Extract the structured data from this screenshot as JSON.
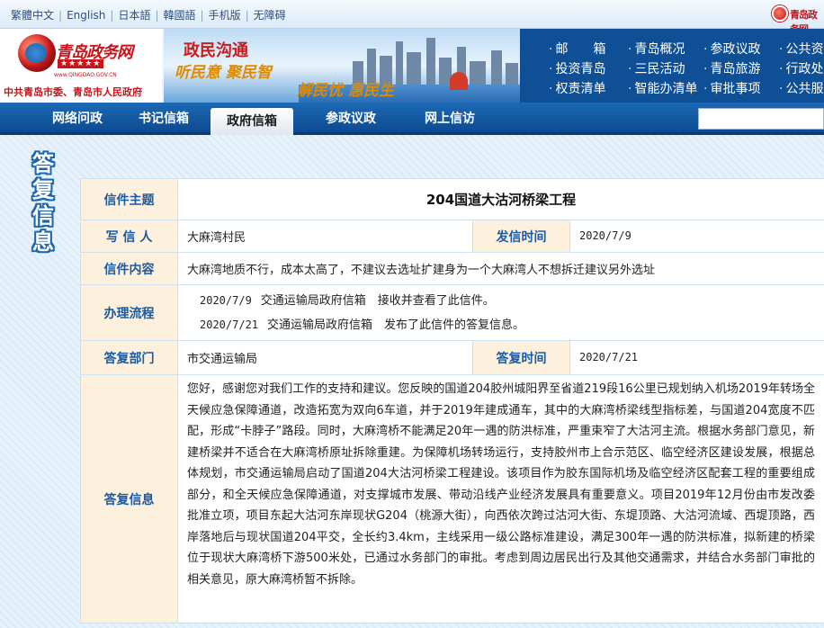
{
  "topbar": {
    "links": [
      "繁體中文",
      "English",
      "日本語",
      "韓國語",
      "手机版",
      "无障碍"
    ],
    "logo_text": "青岛政务网"
  },
  "banner": {
    "site_name": "青岛政务网",
    "stars": "★★★★★",
    "url": "www.QINGDAO.GOV.CN",
    "sub_title": "中共青岛市委、青岛市人民政府",
    "slogan_main": "政民沟通",
    "slogan_line1": "听民意 聚民智",
    "slogan_line2": "解民忧 惠民生",
    "quicklinks": [
      [
        "邮　　箱",
        "青岛概况",
        "参政议政",
        "公共资"
      ],
      [
        "投资青岛",
        "三民活动",
        "青岛旅游",
        "行政处"
      ],
      [
        "权责清单",
        "智能办清单",
        "审批事项",
        "公共服"
      ]
    ]
  },
  "nav": {
    "items": [
      "网络问政",
      "书记信箱",
      "政府信箱",
      "参政议政",
      "网上信访"
    ],
    "active": "政府信箱"
  },
  "side_label": [
    "答",
    "复",
    "信",
    "息"
  ],
  "letter": {
    "subject_label": "信件主题",
    "subject": "204国道大沽河桥梁工程",
    "writer_label": "写 信 人",
    "writer": "大麻湾村民",
    "sent_label": "发信时间",
    "sent_date": "2020/7/9",
    "content_label": "信件内容",
    "content": "大麻湾地质不行，成本太高了，不建议去选址扩建身为一个大麻湾人不想拆迁建议另外选址",
    "process_label": "办理流程",
    "process": [
      {
        "date": "2020/7/9",
        "text": "交通运输局政府信箱　接收并查看了此信件。"
      },
      {
        "date": "2020/7/21",
        "text": "交通运输局政府信箱　发布了此信件的答复信息。"
      }
    ],
    "dept_label": "答复部门",
    "dept": "市交通运输局",
    "reply_date_label": "答复时间",
    "reply_date": "2020/7/21",
    "reply_label": "答复信息",
    "reply": "您好，感谢您对我们工作的支持和建议。您反映的国道204胶州城阳界至省道219段16公里已规划纳入机场2019年转场全天候应急保障通道，改造拓宽为双向6车道，并于2019年建成通车，其中的大麻湾桥梁线型指标差，与国道204宽度不匹配，形成“卡脖子”路段。同时，大麻湾桥不能满足20年一遇的防洪标准，严重束窄了大沽河主流。根据水务部门意见，新建桥梁并不适合在大麻湾桥原址拆除重建。为保障机场转场运行，支持胶州市上合示范区、临空经济区建设发展，根据总体规划，市交通运输局启动了国道204大沽河桥梁工程建设。该项目作为胶东国际机场及临空经济区配套工程的重要组成部分，和全天候应急保障通道，对支撑城市发展、带动沿线产业经济发展具有重要意义。项目2019年12月份由市发改委批准立项，项目东起大沽河东岸现状G204（桃源大街），向西依次跨过沽河大街、东堤顶路、大沽河流域、西堤顶路，西岸落地后与现状国道204平交，全长约3.4km，主线采用一级公路标准建设，满足300年一遇的防洪标准，拟新建的桥梁位于现状大麻湾桥下游500米处，已通过水务部门的审批。考虑到周边居民出行及其他交通需求，并结合水务部门审批的相关意见，原大麻湾桥暂不拆除。"
  }
}
